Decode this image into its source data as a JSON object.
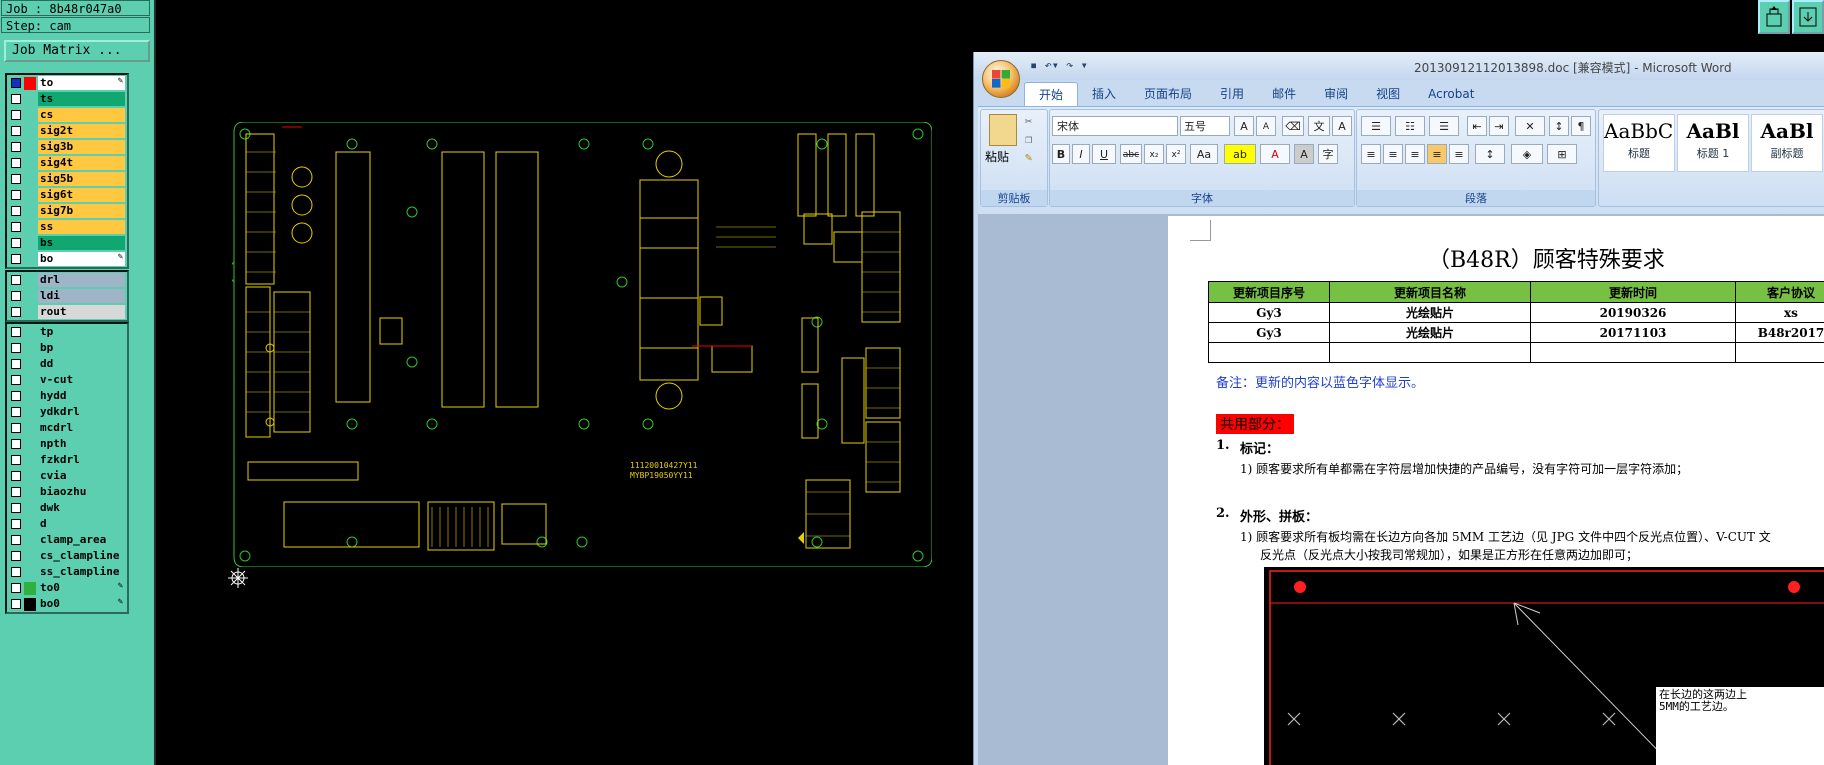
{
  "cam": {
    "job_line": "Job : 8b48r047a0",
    "step_line": "Step: cam",
    "job_matrix": "Job Matrix ...",
    "layers_a": [
      {
        "name": "to",
        "color": "#ffffff",
        "sw": "#ff0000",
        "sel": true,
        "pencil": true
      },
      {
        "name": "ts",
        "color": "#10a870",
        "sw": "",
        "sel": false
      },
      {
        "name": "cs",
        "color": "#ffc840",
        "sw": "",
        "sel": false
      },
      {
        "name": "sig2t",
        "color": "#ffc840",
        "sw": "",
        "sel": false
      },
      {
        "name": "sig3b",
        "color": "#ffc840",
        "sw": "",
        "sel": false
      },
      {
        "name": "sig4t",
        "color": "#ffc840",
        "sw": "",
        "sel": false
      },
      {
        "name": "sig5b",
        "color": "#ffc840",
        "sw": "",
        "sel": false
      },
      {
        "name": "sig6t",
        "color": "#ffc840",
        "sw": "",
        "sel": false
      },
      {
        "name": "sig7b",
        "color": "#ffc840",
        "sw": "",
        "sel": false
      },
      {
        "name": "ss",
        "color": "#ffc840",
        "sw": "",
        "sel": false
      },
      {
        "name": "bs",
        "color": "#10a870",
        "sw": "",
        "sel": false
      },
      {
        "name": "bo",
        "color": "#ffffff",
        "sw": "",
        "sel": false,
        "pencil": true
      }
    ],
    "layers_b": [
      {
        "name": "drl",
        "color": "#a0b4c8"
      },
      {
        "name": "ldi",
        "color": "#a0b4c8"
      },
      {
        "name": "rout",
        "color": "#d8d8d8"
      }
    ],
    "layers_c": [
      {
        "name": "tp",
        "color": "#5ccfb0"
      },
      {
        "name": "bp",
        "color": "#5ccfb0"
      },
      {
        "name": "dd",
        "color": "#5ccfb0"
      },
      {
        "name": "v-cut",
        "color": "#5ccfb0"
      },
      {
        "name": "hydd",
        "color": "#5ccfb0"
      },
      {
        "name": "ydkdrl",
        "color": "#5ccfb0"
      },
      {
        "name": "mcdrl",
        "color": "#5ccfb0"
      },
      {
        "name": "npth",
        "color": "#5ccfb0"
      },
      {
        "name": "fzkdrl",
        "color": "#5ccfb0"
      },
      {
        "name": "cvia",
        "color": "#5ccfb0"
      },
      {
        "name": "biaozhu",
        "color": "#5ccfb0"
      },
      {
        "name": "dwk",
        "color": "#5ccfb0"
      },
      {
        "name": "d",
        "color": "#5ccfb0"
      },
      {
        "name": "clamp_area",
        "color": "#5ccfb0"
      },
      {
        "name": "cs_clampline",
        "color": "#5ccfb0"
      },
      {
        "name": "ss_clampline",
        "color": "#5ccfb0"
      },
      {
        "name": "to0",
        "color": "#5ccfb0",
        "sw": "#30b040",
        "pencil": true
      },
      {
        "name": "bo0",
        "color": "#5ccfb0",
        "sw": "#000000",
        "pencil": true
      }
    ]
  },
  "pcb": {
    "text_line1": "11120010427Y11",
    "text_line2": "MYBP19050YY11"
  },
  "word": {
    "title": "20130912112013898.doc [兼容模式] - Microsoft Word",
    "tabs": [
      "开始",
      "插入",
      "页面布局",
      "引用",
      "邮件",
      "审阅",
      "视图",
      "Acrobat"
    ],
    "active_tab": "开始",
    "font_name": "宋体",
    "font_size": "五号",
    "group_labels": {
      "clipboard": "剪贴板",
      "font": "字体",
      "paragraph": "段落"
    },
    "paste_label": "粘贴",
    "styles": [
      {
        "sample": "AaBbC(",
        "label": "标题"
      },
      {
        "sample": "AaBl",
        "label": "标题 1"
      },
      {
        "sample": "AaBl",
        "label": "副标题"
      }
    ],
    "doc": {
      "title": "（B48R）顾客特殊要求",
      "table_headers": [
        "更新项目序号",
        "更新项目名称",
        "更新时间",
        "客户协议"
      ],
      "table_rows": [
        [
          "Gy3",
          "光绘贴片",
          "20190326",
          "xs"
        ],
        [
          "Gy3",
          "光绘贴片",
          "20171103",
          "B48r2017"
        ],
        [
          "",
          "",
          "",
          ""
        ]
      ],
      "note": "备注：更新的内容以蓝色字体显示。",
      "common": "共用部分：",
      "s1_num": "1.",
      "s1_title": "标记：",
      "s1_item": "1)   顾客要求所有单都需在字符层增加快捷的产品编号，没有字符可加一层字符添加；",
      "s2_num": "2.",
      "s2_title": "外形、拼板：",
      "s2_item_l1": "1)   顾客要求所有板均需在长边方向各加 5MM 工艺边（见 JPG 文件中四个反光点位置）、V-CUT 文",
      "s2_item_l2": "反光点（反光点大小按我司常规加），如果是正方形在任意两边加即可；",
      "img_note_l1": "在长边的这两边上",
      "img_note_l2": "5MM的工艺边。"
    }
  }
}
